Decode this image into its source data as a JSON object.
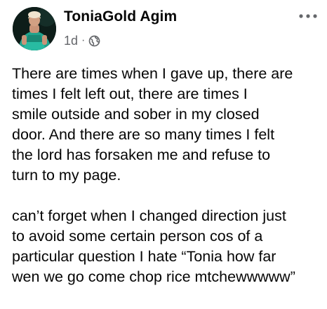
{
  "post": {
    "author": "ToniaGold Agim",
    "timestamp": "1d",
    "separator": "·",
    "audience_icon": "globe-icon",
    "more_icon": "more-options-icon",
    "paragraphs": [
      "There are times when I gave up, there are\ntimes I felt left out, there are times I\nsmile outside and sober in my closed\ndoor. And there are so many times I felt\nthe lord has forsaken me and refuse to\nturn to my page.",
      "can’t forget when I changed direction just\nto avoid some certain person cos of a\nparticular question I hate “Tonia how far\nwen we go come chop rice mtchewwwww”"
    ]
  },
  "colors": {
    "text_primary": "#050505",
    "text_secondary": "#65676b",
    "background": "#ffffff"
  }
}
